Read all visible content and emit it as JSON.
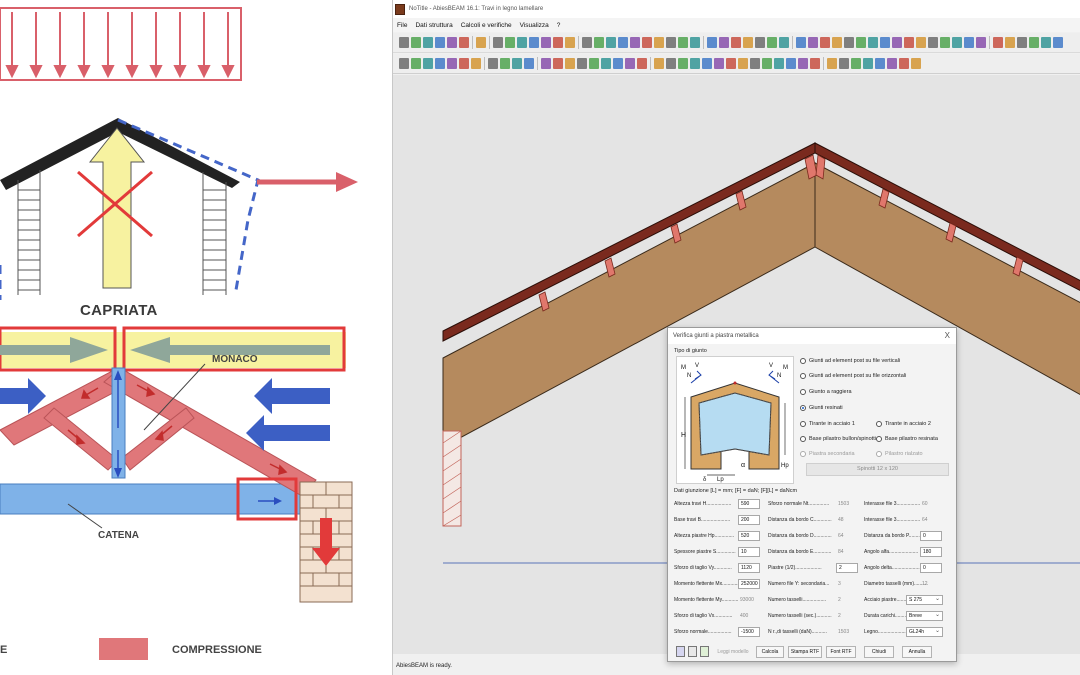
{
  "illustration": {
    "title": "CAPRIATA",
    "monaco_label": "MONACO",
    "catena_label": "CATENA",
    "legend_compression": "COMPRESSIONE",
    "legend_traction_fragment": "E",
    "colors": {
      "compression": "#e0777a",
      "traction": "#7fb2e8",
      "load_arrow": "#d9606a",
      "yellow": "#f7f2a0",
      "highlight": "#e23a3a",
      "force_arrow": "#3c5fc4"
    }
  },
  "app": {
    "window_title": "NoTitle - AbiesBEAM 16.1: Travi in legno lamellare",
    "menu": [
      "File",
      "Dati struttura",
      "Calcoli e verifiche",
      "Visualizza",
      "?"
    ],
    "status": "AbiesBEAM is ready.",
    "dialog": {
      "title": "Verifica giunti a piastra metallica",
      "close_glyph": "X",
      "joint_type_label": "Tipo di giunto",
      "options": [
        "Giunti ad element post su file verticali",
        "Giunti ad element post su file orizzontali",
        "Giunto a raggiera",
        "Giunti resinati",
        "Tirante in acciaio 1",
        "Tirante in acciaio 2",
        "Base pilastro bullon/spinotti",
        "Base pilastro resinata",
        "Piastra secondaria",
        "Pilastro rialzato"
      ],
      "selected_option": "Giunti resinati",
      "plate_button": "Spinotti 12 x 120",
      "data_heading": "Dati giunzione [L] = mm; [F] = daN; [F][L] = daNcm",
      "col1": [
        {
          "label": "Altezza travi H..................",
          "value": "590"
        },
        {
          "label": "Base travi B.....................",
          "value": "200"
        },
        {
          "label": "Altezza piastre Hp..............",
          "value": "520"
        },
        {
          "label": "Spessore piastre S..............",
          "value": "10"
        },
        {
          "label": "Sforzo di taglio Vy.............",
          "value": "1120"
        },
        {
          "label": "Momento flettente Mx............",
          "value": "252000"
        },
        {
          "label": "Momento flettente My............",
          "value": "93000"
        },
        {
          "label": "Sforzo di taglio Vx.............",
          "value": "400"
        },
        {
          "label": "Sforzo normale.................",
          "value": "-1500"
        }
      ],
      "col2": [
        {
          "label": "Sforzo normale Nt...............",
          "value": "1503"
        },
        {
          "label": "Distanza da bordo C.............",
          "value": "48"
        },
        {
          "label": "Distanza da bordo D.............",
          "value": "64"
        },
        {
          "label": "Distanza da bordo E.............",
          "value": "84"
        },
        {
          "label": "Piastre (1/2)...................",
          "value": "2"
        },
        {
          "label": "Numero file Y: secondaria...",
          "value": "3"
        },
        {
          "label": "Numero tasselli.................",
          "value": "2"
        },
        {
          "label": "Numero tasselli (sec.)...........",
          "value": "2"
        },
        {
          "label": "N r.,di tasselli (daN)...........",
          "value": "1503"
        }
      ],
      "col3": [
        {
          "label": "Interasse file 3.................",
          "value": "60"
        },
        {
          "label": "Interasse file 3.................",
          "value": "64"
        },
        {
          "label": "Distanza da bordo P.............",
          "value": "0"
        },
        {
          "label": "Angolo alfa.....................",
          "value": "180"
        },
        {
          "label": "Angolo delta....................",
          "value": "0"
        },
        {
          "label": "Diametro tasselli (mm)..........",
          "value": "12"
        },
        {
          "label": "Acciaio piastre.................",
          "value": "S 275"
        },
        {
          "label": "Durata carichi..................",
          "value": "Breve"
        },
        {
          "label": "Legno...........................",
          "value": "GL24h"
        }
      ],
      "buttons": {
        "disabled": "Leggi modello",
        "calcola": "Calcola",
        "stampa_rtf": "Stampa RTF",
        "font_rtf": "Font RTF",
        "chiudi": "Chiudi",
        "annulla": "Annulla"
      },
      "diagram_labels": {
        "h": "H",
        "hp": "Hp",
        "lp": "Lp",
        "alpha": "α",
        "delta": "δ",
        "m": "M",
        "n": "N",
        "v": "V"
      }
    }
  }
}
